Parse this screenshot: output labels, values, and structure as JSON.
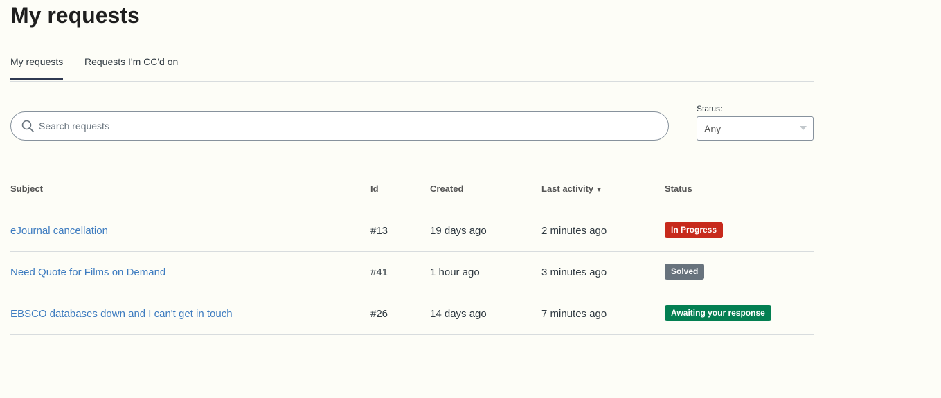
{
  "page": {
    "title": "My requests"
  },
  "tabs": [
    {
      "label": "My requests",
      "active": true
    },
    {
      "label": "Requests I'm CC'd on",
      "active": false
    }
  ],
  "search": {
    "placeholder": "Search requests",
    "value": "",
    "icon": "search-icon"
  },
  "status_filter": {
    "label": "Status:",
    "selected": "Any"
  },
  "table": {
    "headers": {
      "subject": "Subject",
      "id": "Id",
      "created": "Created",
      "last_activity": "Last activity",
      "last_activity_sort_glyph": "▼",
      "status": "Status"
    },
    "rows": [
      {
        "subject": "eJournal cancellation",
        "id": "#13",
        "created": "19 days ago",
        "last_activity": "2 minutes ago",
        "status": "In Progress",
        "status_color": "#c72a1c"
      },
      {
        "subject": "Need Quote for Films on Demand",
        "id": "#41",
        "created": "1 hour ago",
        "last_activity": "3 minutes ago",
        "status": "Solved",
        "status_color": "#68737d"
      },
      {
        "subject": "EBSCO databases down and I can't get in touch",
        "id": "#26",
        "created": "14 days ago",
        "last_activity": "7 minutes ago",
        "status": "Awaiting your response",
        "status_color": "#037f52"
      }
    ]
  },
  "colors": {
    "background": "#fdfdf7",
    "link": "#3e7cc0",
    "active_tab_underline": "#2f3951"
  }
}
